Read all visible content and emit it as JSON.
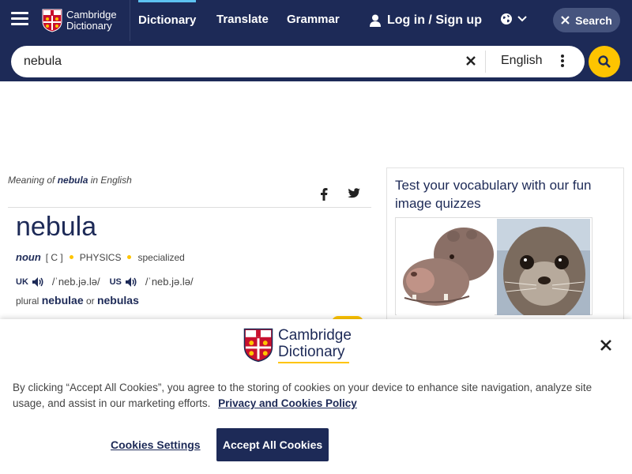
{
  "header": {
    "logo_line1": "Cambridge",
    "logo_line2": "Dictionary",
    "nav": [
      "Dictionary",
      "Translate",
      "Grammar"
    ],
    "login": "Log in / Sign up",
    "search_button": "Search"
  },
  "search": {
    "query": "nebula",
    "language": "English"
  },
  "entry": {
    "meaning_prefix": "Meaning of ",
    "meaning_word": "nebula",
    "meaning_suffix": " in English",
    "headword": "nebula",
    "pos": "noun",
    "grammar": "[ C ]",
    "domain": "PHYSICS",
    "register": "specialized",
    "uk_label": "UK",
    "uk_ipa": "/ˈneb.jə.lə/",
    "us_label": "US",
    "us_ipa": "/ˈneb.jə.lə/",
    "plural_label": "plural",
    "plural1": "nebulae",
    "plural_or": "or",
    "plural2": "nebulas"
  },
  "quiz": {
    "title": "Test your vocabulary with our fun image quizzes"
  },
  "cookie": {
    "logo_line1": "Cambridge",
    "logo_line2": "Dictionary",
    "text": "By clicking “Accept All Cookies”, you agree to the storing of cookies on your device to enhance site navigation, analyze site usage, and assist in our marketing efforts.",
    "policy_link": "Privacy and Cookies Policy",
    "settings": "Cookies Settings",
    "accept": "Accept All Cookies"
  },
  "colors": {
    "brand_navy": "#1d2a57",
    "accent_yellow": "#fec400",
    "active_tab": "#5dc2f0"
  }
}
